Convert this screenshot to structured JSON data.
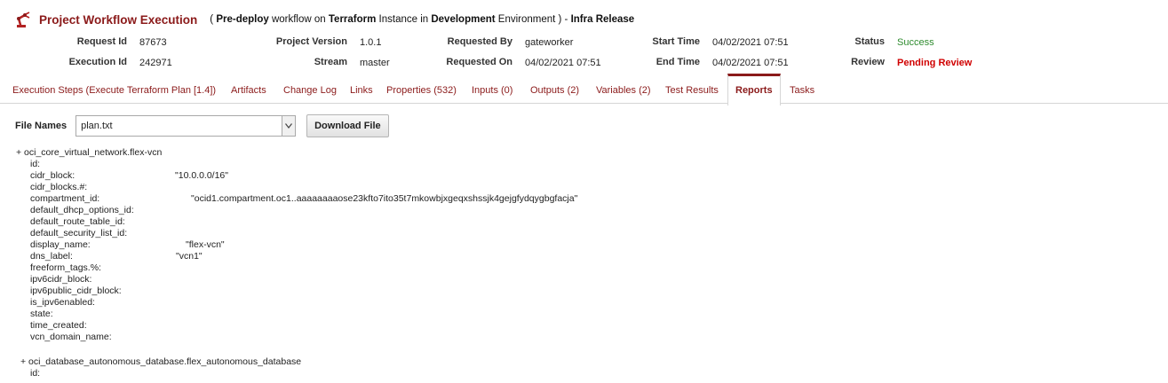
{
  "header": {
    "title": "Project Workflow Execution",
    "sub_open": "( ",
    "sub_stage": "Pre-deploy",
    "sub_text1": " workflow on ",
    "sub_tool": "Terraform",
    "sub_text2": " Instance in ",
    "sub_env": "Development",
    "sub_text3": " Environment ) - ",
    "sub_release": "Infra Release"
  },
  "info": {
    "request_id_label": "Request Id",
    "request_id": "87673",
    "execution_id_label": "Execution Id",
    "execution_id": "242971",
    "project_version_label": "Project Version",
    "project_version": "1.0.1",
    "stream_label": "Stream",
    "stream": "master",
    "requested_by_label": "Requested By",
    "requested_by": "gateworker",
    "requested_on_label": "Requested On",
    "requested_on": "04/02/2021 07:51",
    "start_time_label": "Start Time",
    "start_time": "04/02/2021 07:51",
    "end_time_label": "End Time",
    "end_time": "04/02/2021 07:51",
    "status_label": "Status",
    "status": "Success",
    "review_label": "Review",
    "review": "Pending Review"
  },
  "tabs": [
    "Execution Steps (Execute Terraform Plan [1.4])",
    "Artifacts",
    "Change Log",
    "Links",
    "Properties (532)",
    "Inputs (0)",
    "Outputs (2)",
    "Variables (2)",
    "Test Results",
    "Reports",
    "Tasks"
  ],
  "active_tab": "Reports",
  "file_select": {
    "label": "File Names",
    "value": "plan.txt",
    "button": "Download File"
  },
  "plan": [
    {
      "k": "+ oci_core_virtual_network.flex-vcn",
      "v": ""
    },
    {
      "k": "id:",
      "v": ""
    },
    {
      "k": "cidr_block:",
      "v": "\"10.0.0.0/16\""
    },
    {
      "k": "cidr_blocks.#:",
      "v": ""
    },
    {
      "k": "compartment_id:",
      "v": "\"ocid1.compartment.oc1..aaaaaaaaose23kfto7ito35t7mkowbjxgeqxshssjk4gejgfydqygbgfacja\""
    },
    {
      "k": "default_dhcp_options_id:",
      "v": ""
    },
    {
      "k": "default_route_table_id:",
      "v": ""
    },
    {
      "k": "default_security_list_id:",
      "v": ""
    },
    {
      "k": "display_name:",
      "v": "\"flex-vcn\""
    },
    {
      "k": "dns_label:",
      "v": "\"vcn1\""
    },
    {
      "k": "freeform_tags.%:",
      "v": ""
    },
    {
      "k": "ipv6cidr_block:",
      "v": ""
    },
    {
      "k": "ipv6public_cidr_block:",
      "v": ""
    },
    {
      "k": "is_ipv6enabled:",
      "v": ""
    },
    {
      "k": "state:",
      "v": ""
    },
    {
      "k": "time_created:",
      "v": ""
    },
    {
      "k": "vcn_domain_name:",
      "v": ""
    },
    {
      "k": "+ oci_database_autonomous_database.flex_autonomous_database",
      "v": ""
    },
    {
      "k": "id:",
      "v": ""
    }
  ]
}
